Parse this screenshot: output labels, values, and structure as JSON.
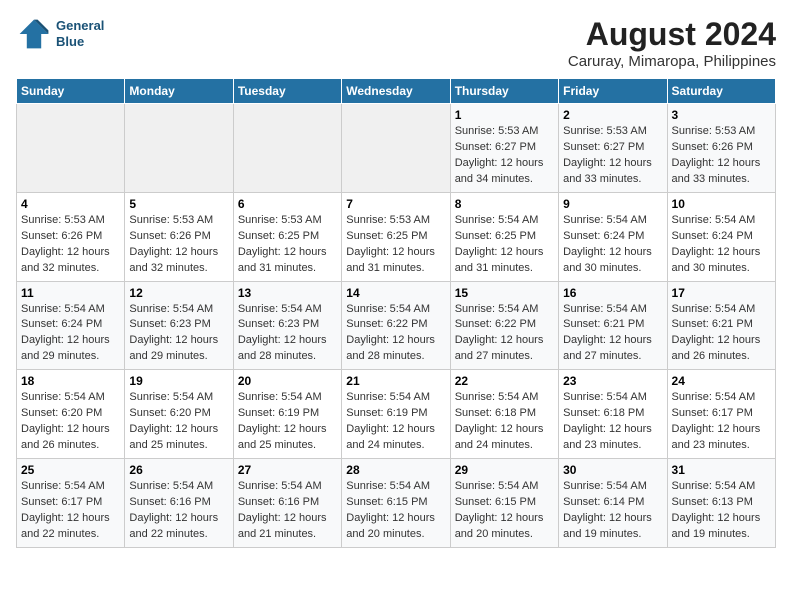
{
  "logo": {
    "line1": "General",
    "line2": "Blue"
  },
  "title": "August 2024",
  "subtitle": "Caruray, Mimaropa, Philippines",
  "days_of_week": [
    "Sunday",
    "Monday",
    "Tuesday",
    "Wednesday",
    "Thursday",
    "Friday",
    "Saturday"
  ],
  "weeks": [
    [
      {
        "day": "",
        "sunrise": "",
        "sunset": "",
        "daylight": ""
      },
      {
        "day": "",
        "sunrise": "",
        "sunset": "",
        "daylight": ""
      },
      {
        "day": "",
        "sunrise": "",
        "sunset": "",
        "daylight": ""
      },
      {
        "day": "",
        "sunrise": "",
        "sunset": "",
        "daylight": ""
      },
      {
        "day": "1",
        "sunrise": "5:53 AM",
        "sunset": "6:27 PM",
        "daylight": "12 hours and 34 minutes."
      },
      {
        "day": "2",
        "sunrise": "5:53 AM",
        "sunset": "6:27 PM",
        "daylight": "12 hours and 33 minutes."
      },
      {
        "day": "3",
        "sunrise": "5:53 AM",
        "sunset": "6:26 PM",
        "daylight": "12 hours and 33 minutes."
      }
    ],
    [
      {
        "day": "4",
        "sunrise": "5:53 AM",
        "sunset": "6:26 PM",
        "daylight": "12 hours and 32 minutes."
      },
      {
        "day": "5",
        "sunrise": "5:53 AM",
        "sunset": "6:26 PM",
        "daylight": "12 hours and 32 minutes."
      },
      {
        "day": "6",
        "sunrise": "5:53 AM",
        "sunset": "6:25 PM",
        "daylight": "12 hours and 31 minutes."
      },
      {
        "day": "7",
        "sunrise": "5:53 AM",
        "sunset": "6:25 PM",
        "daylight": "12 hours and 31 minutes."
      },
      {
        "day": "8",
        "sunrise": "5:54 AM",
        "sunset": "6:25 PM",
        "daylight": "12 hours and 31 minutes."
      },
      {
        "day": "9",
        "sunrise": "5:54 AM",
        "sunset": "6:24 PM",
        "daylight": "12 hours and 30 minutes."
      },
      {
        "day": "10",
        "sunrise": "5:54 AM",
        "sunset": "6:24 PM",
        "daylight": "12 hours and 30 minutes."
      }
    ],
    [
      {
        "day": "11",
        "sunrise": "5:54 AM",
        "sunset": "6:24 PM",
        "daylight": "12 hours and 29 minutes."
      },
      {
        "day": "12",
        "sunrise": "5:54 AM",
        "sunset": "6:23 PM",
        "daylight": "12 hours and 29 minutes."
      },
      {
        "day": "13",
        "sunrise": "5:54 AM",
        "sunset": "6:23 PM",
        "daylight": "12 hours and 28 minutes."
      },
      {
        "day": "14",
        "sunrise": "5:54 AM",
        "sunset": "6:22 PM",
        "daylight": "12 hours and 28 minutes."
      },
      {
        "day": "15",
        "sunrise": "5:54 AM",
        "sunset": "6:22 PM",
        "daylight": "12 hours and 27 minutes."
      },
      {
        "day": "16",
        "sunrise": "5:54 AM",
        "sunset": "6:21 PM",
        "daylight": "12 hours and 27 minutes."
      },
      {
        "day": "17",
        "sunrise": "5:54 AM",
        "sunset": "6:21 PM",
        "daylight": "12 hours and 26 minutes."
      }
    ],
    [
      {
        "day": "18",
        "sunrise": "5:54 AM",
        "sunset": "6:20 PM",
        "daylight": "12 hours and 26 minutes."
      },
      {
        "day": "19",
        "sunrise": "5:54 AM",
        "sunset": "6:20 PM",
        "daylight": "12 hours and 25 minutes."
      },
      {
        "day": "20",
        "sunrise": "5:54 AM",
        "sunset": "6:19 PM",
        "daylight": "12 hours and 25 minutes."
      },
      {
        "day": "21",
        "sunrise": "5:54 AM",
        "sunset": "6:19 PM",
        "daylight": "12 hours and 24 minutes."
      },
      {
        "day": "22",
        "sunrise": "5:54 AM",
        "sunset": "6:18 PM",
        "daylight": "12 hours and 24 minutes."
      },
      {
        "day": "23",
        "sunrise": "5:54 AM",
        "sunset": "6:18 PM",
        "daylight": "12 hours and 23 minutes."
      },
      {
        "day": "24",
        "sunrise": "5:54 AM",
        "sunset": "6:17 PM",
        "daylight": "12 hours and 23 minutes."
      }
    ],
    [
      {
        "day": "25",
        "sunrise": "5:54 AM",
        "sunset": "6:17 PM",
        "daylight": "12 hours and 22 minutes."
      },
      {
        "day": "26",
        "sunrise": "5:54 AM",
        "sunset": "6:16 PM",
        "daylight": "12 hours and 22 minutes."
      },
      {
        "day": "27",
        "sunrise": "5:54 AM",
        "sunset": "6:16 PM",
        "daylight": "12 hours and 21 minutes."
      },
      {
        "day": "28",
        "sunrise": "5:54 AM",
        "sunset": "6:15 PM",
        "daylight": "12 hours and 20 minutes."
      },
      {
        "day": "29",
        "sunrise": "5:54 AM",
        "sunset": "6:15 PM",
        "daylight": "12 hours and 20 minutes."
      },
      {
        "day": "30",
        "sunrise": "5:54 AM",
        "sunset": "6:14 PM",
        "daylight": "12 hours and 19 minutes."
      },
      {
        "day": "31",
        "sunrise": "5:54 AM",
        "sunset": "6:13 PM",
        "daylight": "12 hours and 19 minutes."
      }
    ]
  ],
  "labels": {
    "sunrise": "Sunrise:",
    "sunset": "Sunset:",
    "daylight": "Daylight:"
  }
}
